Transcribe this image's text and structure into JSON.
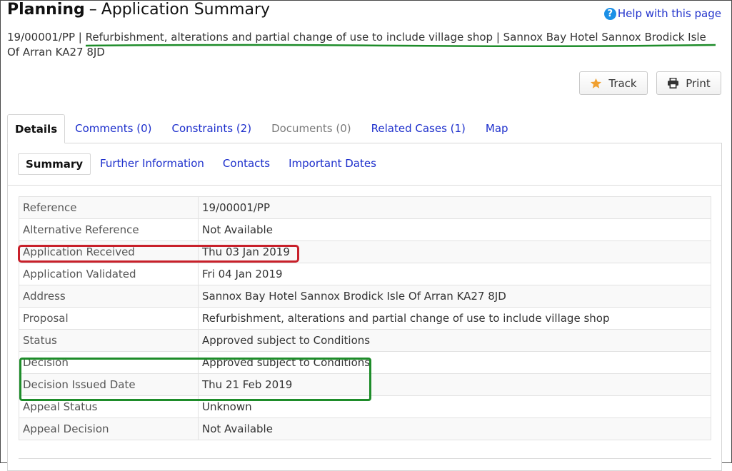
{
  "header": {
    "title_strong": "Planning",
    "title_dash": "–",
    "title_rest": "Application Summary",
    "help_label": "Help with this page",
    "help_glyph": "?"
  },
  "subtitle": {
    "text": "19/00001/PP | Refurbishment, alterations and partial change of use to include village shop | Sannox Bay Hotel Sannox Brodick Isle Of Arran KA27 8JD"
  },
  "actions": {
    "track_label": "Track",
    "print_label": "Print"
  },
  "tabs": [
    {
      "label": "Details"
    },
    {
      "label": "Comments (0)"
    },
    {
      "label": "Constraints (2)"
    },
    {
      "label": "Documents (0)"
    },
    {
      "label": "Related Cases (1)"
    },
    {
      "label": "Map"
    }
  ],
  "subtabs": [
    {
      "label": "Summary"
    },
    {
      "label": "Further Information"
    },
    {
      "label": "Contacts"
    },
    {
      "label": "Important Dates"
    }
  ],
  "details": [
    {
      "key": "Reference",
      "value": "19/00001/PP"
    },
    {
      "key": "Alternative Reference",
      "value": "Not Available"
    },
    {
      "key": "Application Received",
      "value": "Thu 03 Jan 2019"
    },
    {
      "key": "Application Validated",
      "value": "Fri 04 Jan 2019"
    },
    {
      "key": "Address",
      "value": "Sannox Bay Hotel Sannox Brodick Isle Of Arran KA27 8JD"
    },
    {
      "key": "Proposal",
      "value": "Refurbishment, alterations and partial change of use to include village shop"
    },
    {
      "key": "Status",
      "value": "Approved subject to Conditions"
    },
    {
      "key": "Decision",
      "value": "Approved subject to Conditions"
    },
    {
      "key": "Decision Issued Date",
      "value": "Thu 21 Feb 2019"
    },
    {
      "key": "Appeal Status",
      "value": "Unknown"
    },
    {
      "key": "Appeal Decision",
      "value": "Not Available"
    }
  ],
  "colors": {
    "link": "#1d2fcc",
    "highlight_red": "#c8202a",
    "highlight_green": "#1e8c2a",
    "star": "#f0a030"
  }
}
